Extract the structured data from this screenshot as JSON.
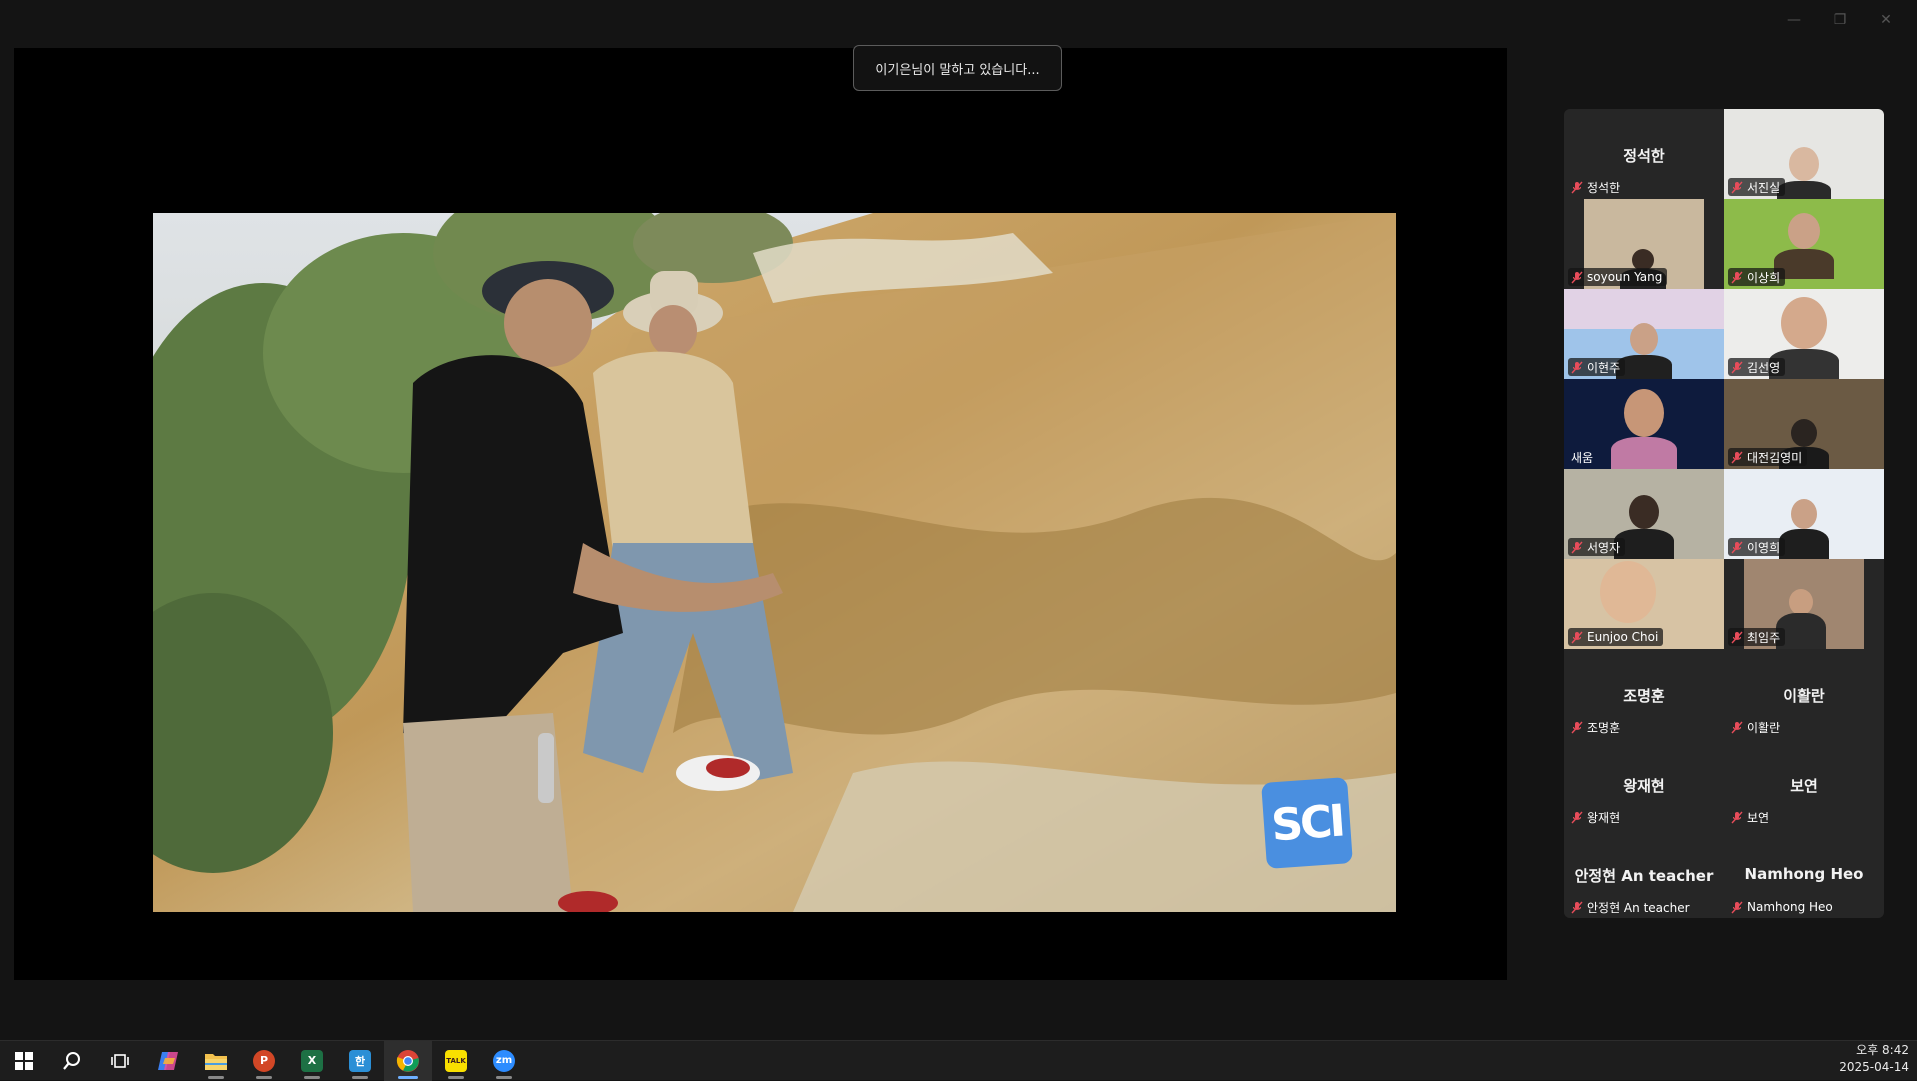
{
  "window_controls": [
    "minimize",
    "restore",
    "close"
  ],
  "speaking_toast": "이기은님이 말하고 있습니다...",
  "shared_video": {
    "logo_text": "SCI"
  },
  "gallery": {
    "tiles": [
      {
        "name": "정석한",
        "big_name": "정석한",
        "video": false,
        "muted": true
      },
      {
        "name": "서진실",
        "video": true,
        "muted": true
      },
      {
        "name": "soyoun Yang",
        "video": true,
        "muted": true
      },
      {
        "name": "이상희",
        "video": true,
        "muted": true
      },
      {
        "name": "이현주",
        "video": true,
        "muted": true
      },
      {
        "name": "김선영",
        "video": true,
        "muted": true
      },
      {
        "name": "새움",
        "video": true,
        "muted": false
      },
      {
        "name": "대전김영미",
        "video": true,
        "muted": true
      },
      {
        "name": "서영자",
        "video": true,
        "muted": true
      },
      {
        "name": "이영희",
        "video": true,
        "muted": true
      },
      {
        "name": "Eunjoo Choi",
        "video": true,
        "muted": true
      },
      {
        "name": "최임주",
        "video": true,
        "muted": true
      },
      {
        "name": "조명훈",
        "big_name": "조명훈",
        "video": false,
        "muted": true
      },
      {
        "name": "이활란",
        "big_name": "이활란",
        "video": false,
        "muted": true
      },
      {
        "name": "왕재현",
        "big_name": "왕재현",
        "video": false,
        "muted": true
      },
      {
        "name": "보연",
        "big_name": "보연",
        "video": false,
        "muted": true
      },
      {
        "name": "안정현 An teacher",
        "big_name": "안정현 An teacher",
        "video": false,
        "muted": true
      },
      {
        "name": "Namhong Heo",
        "big_name": "Namhong Heo",
        "video": false,
        "muted": true
      }
    ]
  },
  "taskbar": {
    "apps": [
      "start-icon",
      "search-icon",
      "task-view-icon",
      "copilot-icon",
      "file-explorer-icon",
      "powerpoint-icon",
      "excel-icon",
      "hancom-icon",
      "chrome-icon",
      "kakaotalk-icon",
      "zoom-icon"
    ],
    "excel_letter": "X",
    "powerpoint_letter": "P",
    "kakao_text": "TALK",
    "zoom_text": "zm",
    "hancom_letter": "한"
  },
  "clock": {
    "time": "오후 8:42",
    "date": "2025-04-14"
  }
}
